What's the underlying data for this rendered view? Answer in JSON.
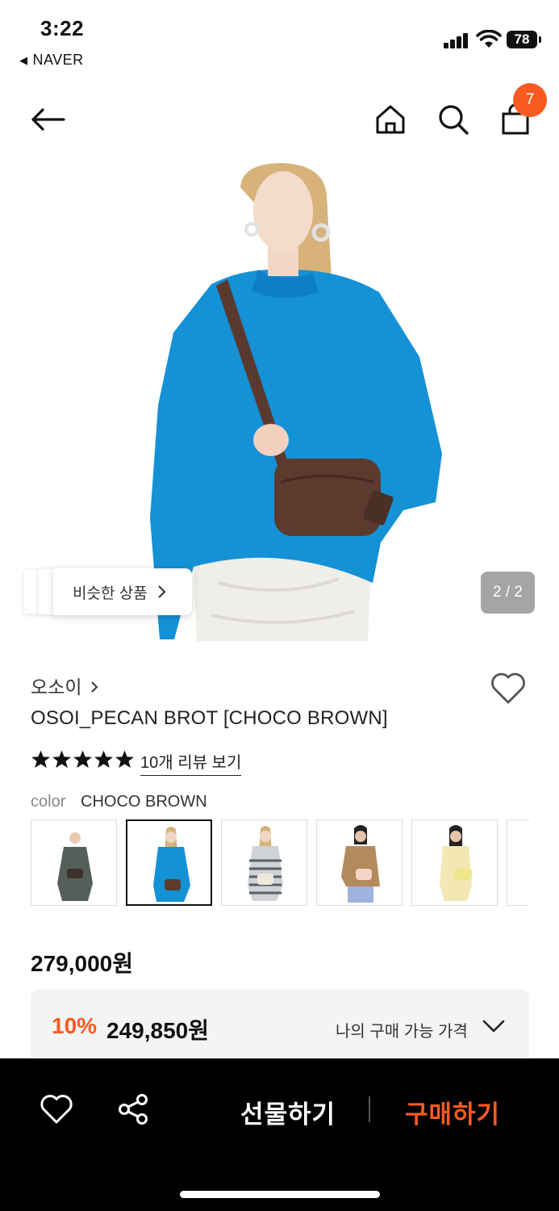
{
  "status_bar": {
    "time": "3:22",
    "back_app": "NAVER",
    "battery": "78"
  },
  "nav": {
    "back_icon": "arrow-left-icon",
    "home_icon": "home-icon",
    "search_icon": "search-icon",
    "cart_icon": "shopping-bag-icon",
    "cart_count": "7",
    "badge_color": "#f95a1f"
  },
  "hero": {
    "similar_label": "비슷한 상품",
    "counter": "2 / 2"
  },
  "product": {
    "brand": "오소이",
    "title": "OSOI_PECAN BROT [CHOCO BROWN]",
    "rating_stars": 5,
    "review_link": "10개 리뷰 보기",
    "color_label": "color",
    "color_value": "CHOCO BROWN",
    "swatches": [
      {
        "name": "gray",
        "selected": false
      },
      {
        "name": "blue",
        "selected": true
      },
      {
        "name": "stripe",
        "selected": false
      },
      {
        "name": "tan",
        "selected": false
      },
      {
        "name": "yellow",
        "selected": false
      },
      {
        "name": "more",
        "selected": false
      }
    ],
    "price": "279,000원"
  },
  "discount": {
    "percent": "10%",
    "price": "249,850원",
    "label": "나의 구매 가능 가격"
  },
  "bottom_bar": {
    "wish_icon": "heart-icon",
    "share_icon": "share-icon",
    "gift_label": "선물하기",
    "buy_label": "구매하기",
    "accent": "#f95a1f"
  }
}
